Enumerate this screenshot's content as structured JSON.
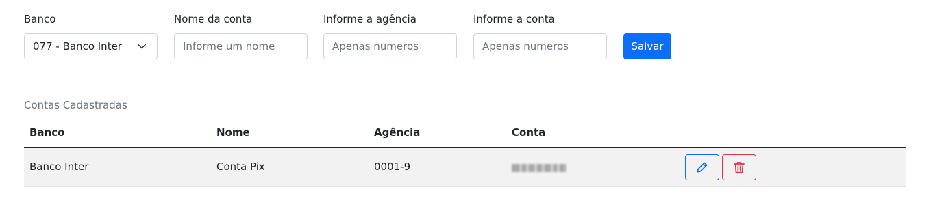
{
  "form": {
    "bank_label": "Banco",
    "bank_selected": "077 - Banco Inter",
    "account_name_label": "Nome da conta",
    "account_name_placeholder": "Informe um nome",
    "agency_label": "Informe a agência",
    "agency_placeholder": "Apenas numeros",
    "account_label": "Informe a conta",
    "account_placeholder": "Apenas numeros",
    "save_label": "Salvar"
  },
  "accounts": {
    "title": "Contas Cadastradas",
    "columns": [
      "Banco",
      "Nome",
      "Agência",
      "Conta"
    ],
    "rows": [
      {
        "bank": "Banco Inter",
        "name": "Conta Pix",
        "agency": "0001-9"
      }
    ]
  },
  "colors": {
    "primary": "#0d6efd",
    "danger": "#dc3545",
    "row_bg": "#f2f2f2",
    "muted_text": "#6c757d"
  },
  "icons": {
    "select_caret": "chevron-down-icon",
    "edit": "pencil-icon",
    "delete": "trash-icon"
  }
}
